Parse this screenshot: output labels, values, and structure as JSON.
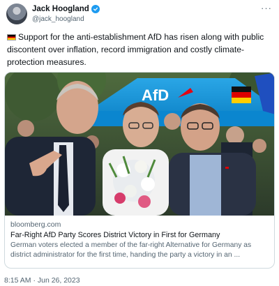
{
  "author": {
    "display_name": "Jack Hoogland",
    "handle": "@jack_hoogland",
    "verified": true
  },
  "tweet": {
    "flag": "germany-flag",
    "text": "Support for the anti-establishment AfD has risen along with public discontent over inflation, record immigration and costly climate-protection measures."
  },
  "card": {
    "image_sign": "AfD",
    "domain": "bloomberg.com",
    "title": "Far-Right AfD Party Scores District Victory in First for Germany",
    "description": "German voters elected a member of the far-right Alternative for Germany as district administrator for the first time, handing the party a victory in an ..."
  },
  "meta": {
    "timestamp": "8:15 AM · Jun 26, 2023"
  },
  "colors": {
    "verified": "#1d9bf0",
    "text": "#0f1419",
    "secondary": "#536471",
    "border": "#cfd9de",
    "afd_blue": "#0a8fd6"
  }
}
